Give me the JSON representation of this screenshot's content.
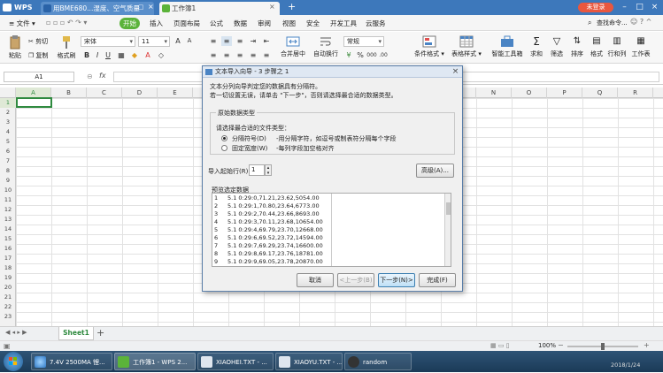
{
  "titlebar": {
    "app": "WPS",
    "tabs": [
      {
        "label": "用BME680...湿度、空气质量"
      },
      {
        "label": "工作簿1"
      }
    ],
    "login": "未登录"
  },
  "menubar": {
    "file": "文件",
    "items": [
      "开始",
      "插入",
      "页面布局",
      "公式",
      "数据",
      "审阅",
      "视图",
      "安全",
      "开发工具",
      "云服务"
    ],
    "search": "查找命令..."
  },
  "ribbon": {
    "paste": "粘贴",
    "cut": "剪切",
    "copy": "复制",
    "format_painter": "格式刷",
    "font_name": "宋体",
    "font_size": "11",
    "merge_center": "合并居中",
    "wrap_text": "自动换行",
    "number_format": "常规",
    "conditional_format": "条件格式",
    "table_style": "表格样式",
    "smart_toolbox": "智能工具箱",
    "sum": "求和",
    "filter": "筛选",
    "sort": "排序",
    "format": "格式",
    "rows_cols": "行和列",
    "worksheet": "工作表"
  },
  "formulabar": {
    "cell_ref": "A1",
    "fx": "fx"
  },
  "grid": {
    "columns": [
      "A",
      "B",
      "C",
      "D",
      "E",
      "F",
      "G",
      "H",
      "I",
      "J",
      "K",
      "L",
      "M",
      "N",
      "O",
      "P",
      "Q",
      "R"
    ],
    "rows": [
      "1",
      "2",
      "3",
      "4",
      "5",
      "6",
      "7",
      "8",
      "9",
      "10",
      "11",
      "12",
      "13",
      "14",
      "15",
      "16",
      "17",
      "18",
      "19",
      "20",
      "21",
      "22",
      "23"
    ]
  },
  "sheet_tab": "Sheet1",
  "statusbar": {
    "zoom": "100%"
  },
  "dialog": {
    "title": "文本导入向导 - 3 步骤之 1",
    "intro_line1": "文本分列向导判定您的数据具有分隔符。",
    "intro_line2": "若一切设置无误，请单击 \"下一步\"，否则请选择最合适的数据类型。",
    "group_label": "原始数据类型",
    "choose_label": "请选择最合适的文件类型：",
    "option_delimited": "分隔符号(D)",
    "option_delimited_desc": "-用分隔字符，如逗号或制表符分隔每个字段",
    "option_fixed": "固定宽度(W)",
    "option_fixed_desc": "-每列字段加空格对齐",
    "start_row_label": "导入起始行(R):",
    "start_row_value": "1",
    "advanced_button": "高级(A)...",
    "preview_label": "预览选定数据",
    "preview_rows": [
      {
        "n": "1",
        "text": "5.1 0:29:0,71.21,23.62,5054.00"
      },
      {
        "n": "2",
        "text": "5.1 0:29:1,70.80,23.64,6773.00"
      },
      {
        "n": "3",
        "text": "5.1 0:29:2,70.44,23.66,8693.00"
      },
      {
        "n": "4",
        "text": "5.1 0:29:3,70.11,23.68,10654.00"
      },
      {
        "n": "5",
        "text": "5.1 0:29:4,69.79,23.70,12668.00"
      },
      {
        "n": "6",
        "text": "5.1 0:29:6,69.52,23.72,14594.00"
      },
      {
        "n": "7",
        "text": "5.1 0:29:7,69.29,23.74,16600.00"
      },
      {
        "n": "8",
        "text": "5.1 0:29:8,69.17,23.76,18781.00"
      },
      {
        "n": "9",
        "text": "5.1 0:29:9,69.05,23.78,20870.00"
      }
    ],
    "cancel_button": "取消",
    "back_button": "<上一步(B)",
    "next_button": "下一步(N)>",
    "finish_button": "完成(F)"
  },
  "taskbar": {
    "items": [
      {
        "label": "7.4V 2500MA 锂..."
      },
      {
        "label": "工作簿1 - WPS 2..."
      },
      {
        "label": "XIAOHEI.TXT - ..."
      },
      {
        "label": "XIAOYU.TXT - ..."
      },
      {
        "label": "random"
      }
    ],
    "clock": "2018/1/24"
  },
  "colors": {
    "title_blue": "#3d78bb",
    "menu_active_green": "#5bb33a",
    "login_red": "#e9573f",
    "selection_green": "#2f8a3f"
  }
}
